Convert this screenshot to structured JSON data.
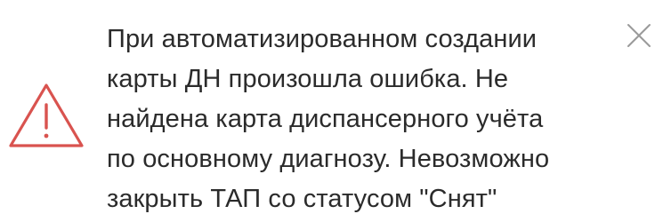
{
  "notification": {
    "type": "warning",
    "icon": "warning-triangle-icon",
    "close_icon": "close-icon",
    "accent_color": "#d9534f",
    "text_color": "#2b2b2b",
    "message_lines": [
      "При автоматизированном создании",
      "карты ДН произошла ошибка. Не",
      "найдена карта диспансерного учёта",
      "по основному диагнозу. Невозможно",
      "закрыть ТАП со статусом \"Снят\""
    ]
  }
}
